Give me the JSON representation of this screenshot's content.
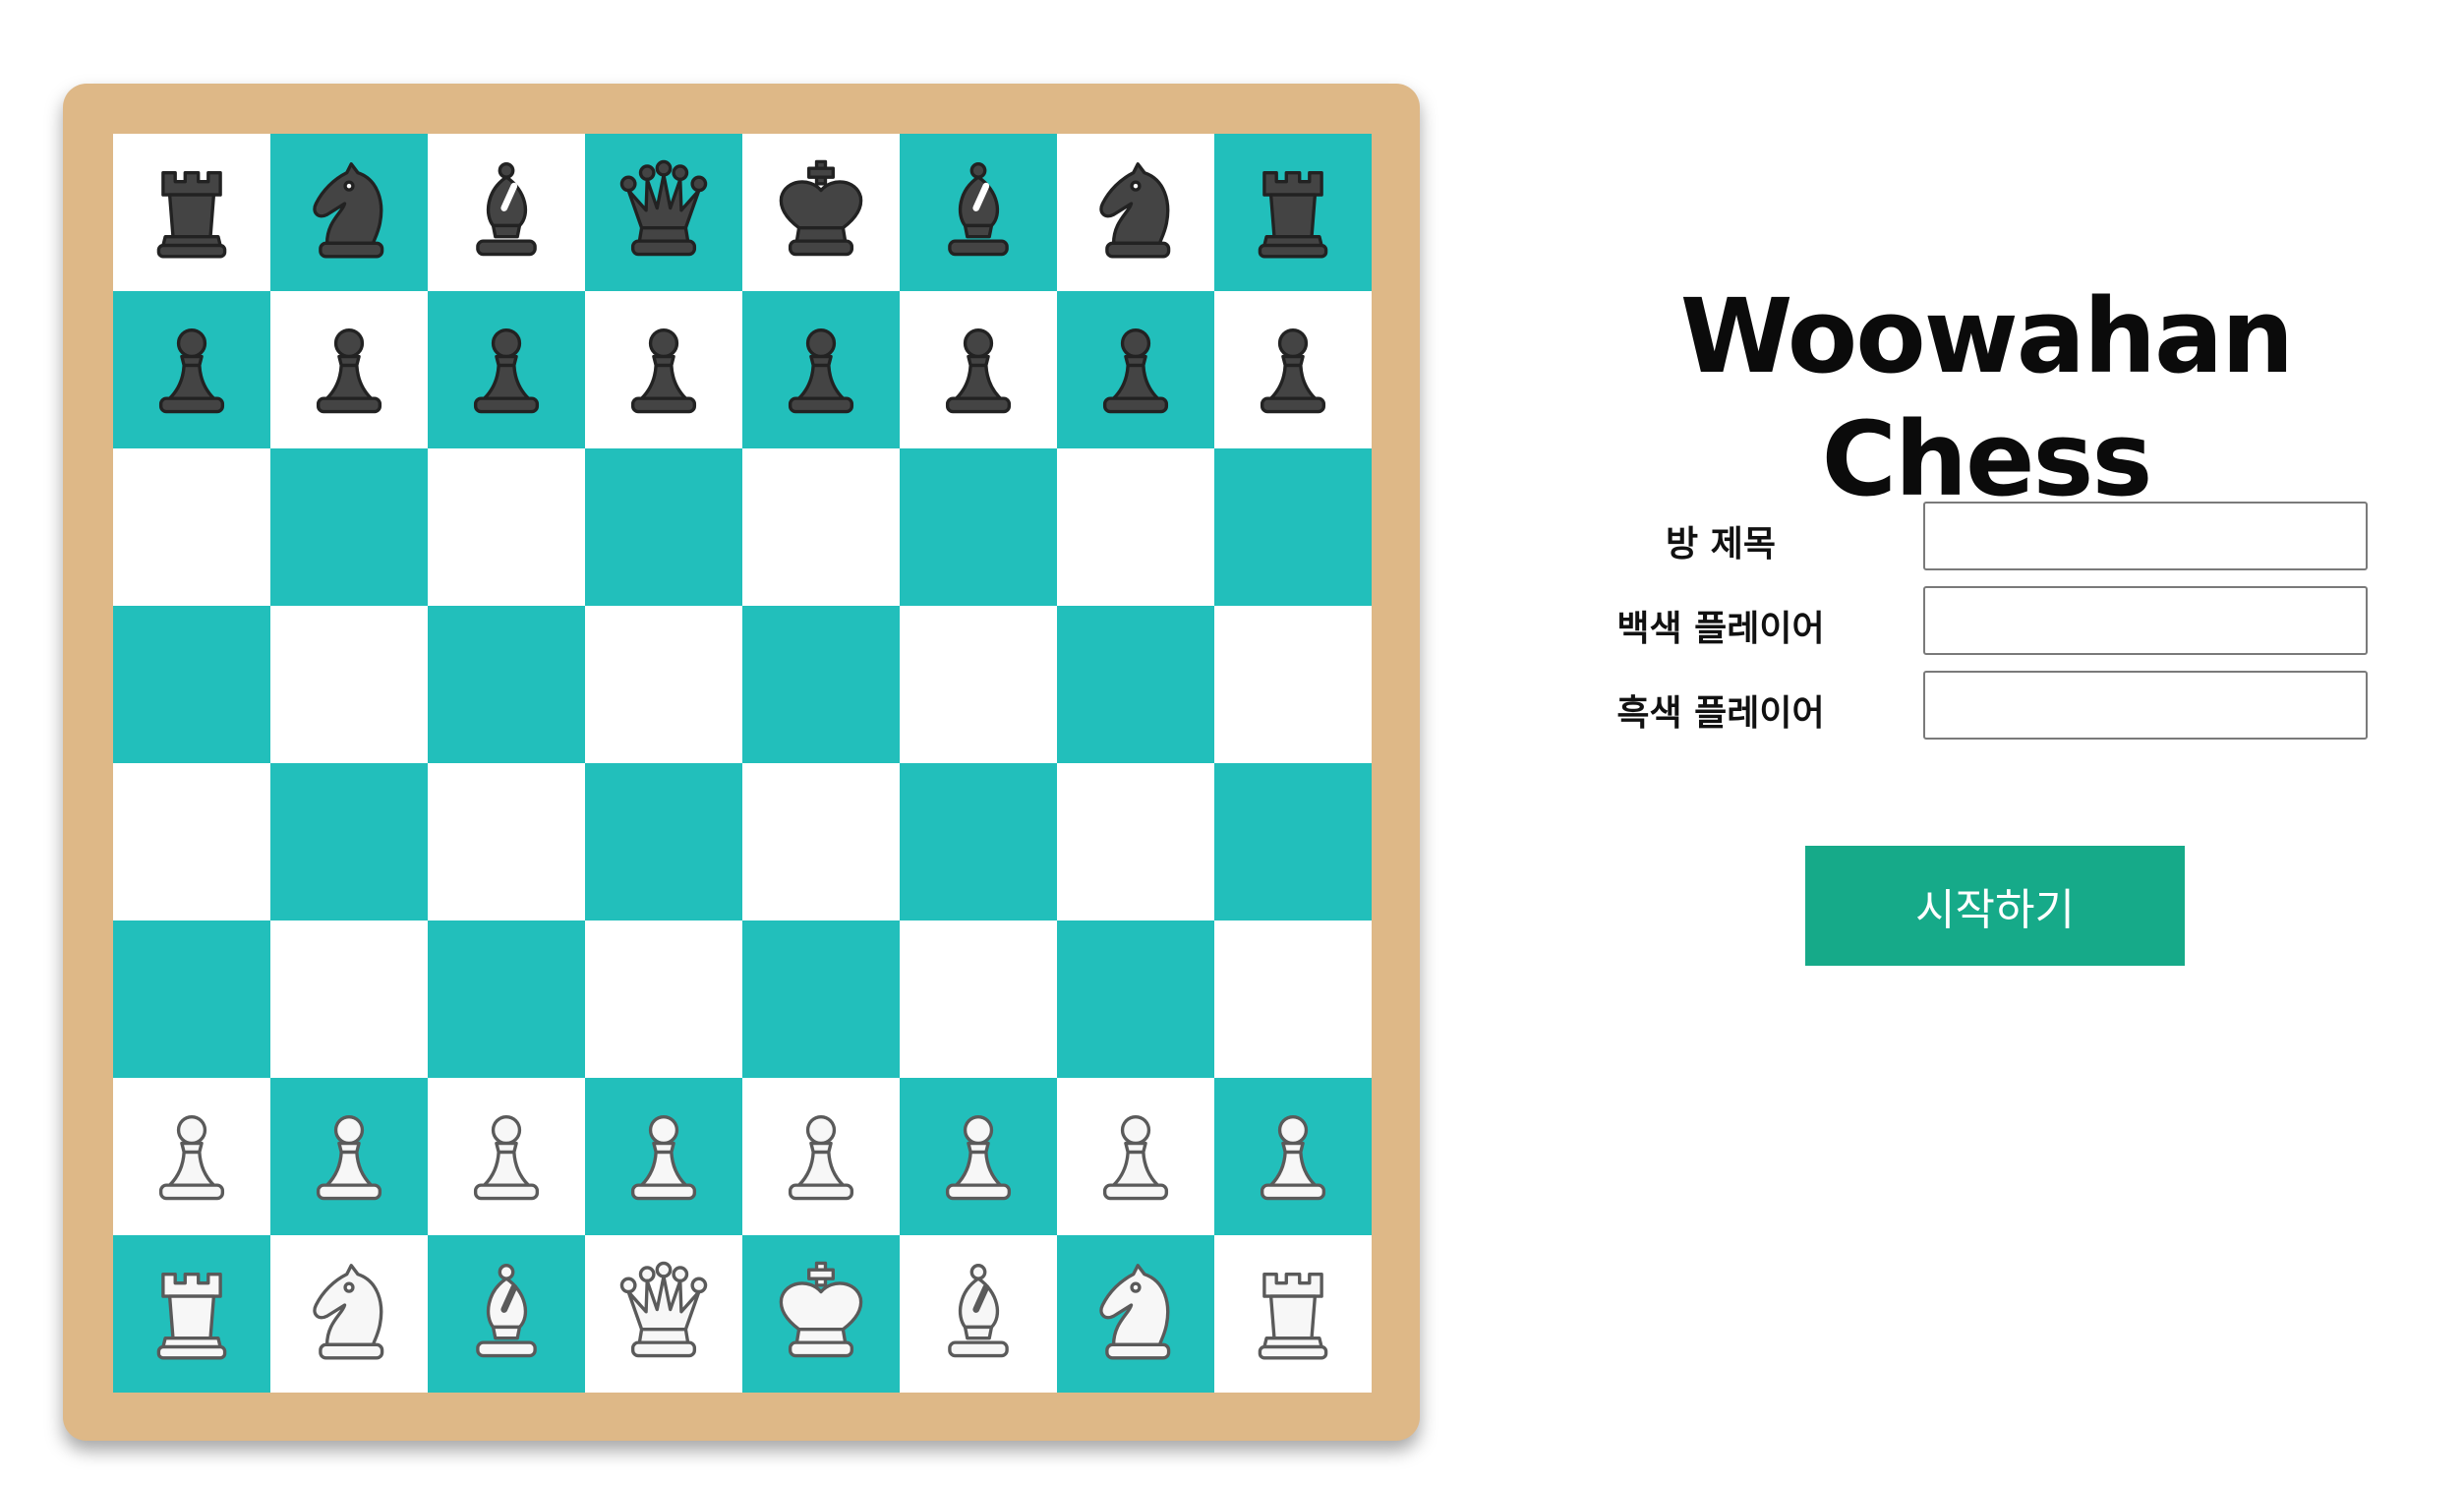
{
  "app": {
    "title": "Woowahan Chess"
  },
  "colors": {
    "board_frame": "#deb887",
    "dark_square": "#22bfbb",
    "light_square": "#ffffff",
    "button": "#16aa89",
    "black_piece": "#444444",
    "white_piece": "#f7f7f7"
  },
  "form": {
    "room_title_label": "방 제목",
    "room_title_value": "",
    "white_player_label": "백색 플레이어",
    "white_player_value": "",
    "black_player_label": "흑색 플레이어",
    "black_player_value": "",
    "start_button_label": "시작하기"
  },
  "board": {
    "orientation": "black-top",
    "ranks": [
      [
        "black-rook",
        "black-knight",
        "black-bishop",
        "black-queen",
        "black-king",
        "black-bishop",
        "black-knight",
        "black-rook"
      ],
      [
        "black-pawn",
        "black-pawn",
        "black-pawn",
        "black-pawn",
        "black-pawn",
        "black-pawn",
        "black-pawn",
        "black-pawn"
      ],
      [
        "",
        "",
        "",
        "",
        "",
        "",
        "",
        ""
      ],
      [
        "",
        "",
        "",
        "",
        "",
        "",
        "",
        ""
      ],
      [
        "",
        "",
        "",
        "",
        "",
        "",
        "",
        ""
      ],
      [
        "",
        "",
        "",
        "",
        "",
        "",
        "",
        ""
      ],
      [
        "white-pawn",
        "white-pawn",
        "white-pawn",
        "white-pawn",
        "white-pawn",
        "white-pawn",
        "white-pawn",
        "white-pawn"
      ],
      [
        "white-rook",
        "white-knight",
        "white-bishop",
        "white-queen",
        "white-king",
        "white-bishop",
        "white-knight",
        "white-rook"
      ]
    ]
  }
}
